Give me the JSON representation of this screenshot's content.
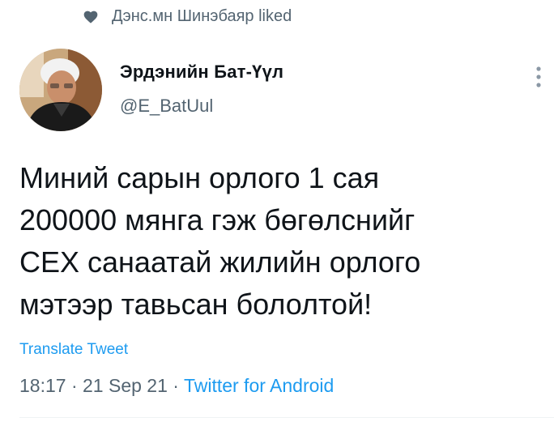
{
  "social_context": {
    "icon": "heart-icon",
    "text": "Дэнс.мн Шинэбаяр liked"
  },
  "author": {
    "name": "Эрдэнийн Бат-Үүл",
    "handle": "@E_BatUul"
  },
  "tweet": {
    "lines": [
      "Миний сарын орлого 1 сая",
      "200000 мянга гэж бөгөлснийг",
      "СЕХ санаатай жилийн орлого",
      "мэтээр тавьсан бололтой!"
    ]
  },
  "translate_label": "Translate Tweet",
  "meta": {
    "time": "18:17",
    "date": "21 Sep 21",
    "separator": "·",
    "source": "Twitter for Android"
  },
  "colors": {
    "accent": "#1d9bf0",
    "secondary_text": "#536471",
    "primary_text": "#0f1419"
  }
}
